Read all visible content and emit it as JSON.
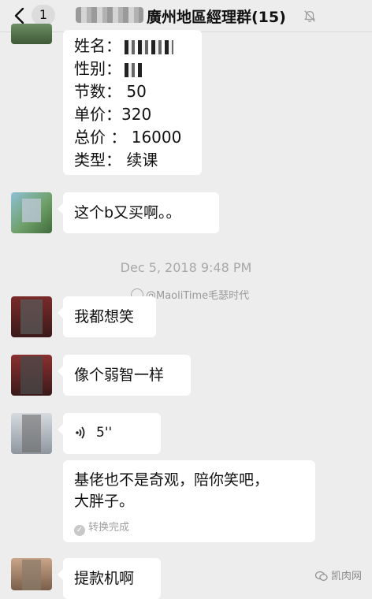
{
  "header": {
    "unread_count": "1",
    "title": "廣州地區經理群(15)"
  },
  "messages": {
    "order": {
      "name_label": "姓名：",
      "gender_label": "性别：",
      "sessions": "节数：  50",
      "unit_price": "单价：320",
      "total": "总价 ：  16000",
      "type": "类型：  续课"
    },
    "m1": "这个b又买啊。。",
    "timestamp": "Dec 5, 2018 9:48 PM",
    "m2": "我都想笑",
    "m3": "像个弱智一样",
    "voice_duration": "5''",
    "transcript_line1": "基佬也不是奇观，陪你笑吧，",
    "transcript_line2": "大胖子。",
    "transcript_status": "转换完成",
    "m4": "提款机啊"
  },
  "watermarks": {
    "weibo": "@MaoliTime毛瑟时代",
    "corner": "凯肉网"
  },
  "icons": {
    "back": "chevron-left-icon",
    "mute": "bell-muted-icon",
    "voice": "sound-wave-icon",
    "check": "check-circle-icon"
  },
  "colors": {
    "background": "#ededed",
    "bubble": "#ffffff",
    "timestamp": "#a8a8a8"
  }
}
